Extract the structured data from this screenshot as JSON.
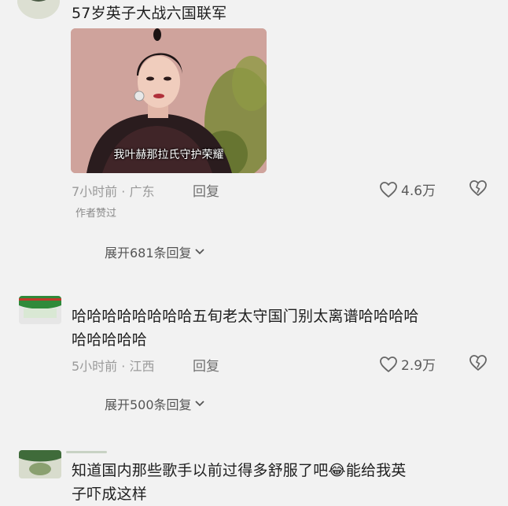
{
  "comments": [
    {
      "text": "57岁英子大战六国联军",
      "image_caption": "我叶赫那拉氏守护荣耀",
      "time_location": "7小时前 · 广东",
      "reply_label": "回复",
      "likes": "4.6万",
      "author_liked": "作者赞过",
      "expand_label": "展开681条回复"
    },
    {
      "text_line1": "哈哈哈哈哈哈哈哈五旬老太守国门别太离谱哈哈哈哈",
      "text_line2": "哈哈哈哈哈",
      "time_location": "5小时前 · 江西",
      "reply_label": "回复",
      "likes": "2.9万",
      "expand_label": "展开500条回复"
    },
    {
      "text_line1_a": "知道国内那些歌手以前过得多舒服了吧",
      "emoji": "😂",
      "text_line1_b": "能给我英",
      "text_line2": "子吓成这样"
    }
  ],
  "icons": {
    "like": "heart-outline-icon",
    "dislike": "broken-heart-icon",
    "expand": "chevron-down-icon"
  },
  "colors": {
    "background": "#f2f2f2",
    "meta": "#9a9a9a"
  }
}
